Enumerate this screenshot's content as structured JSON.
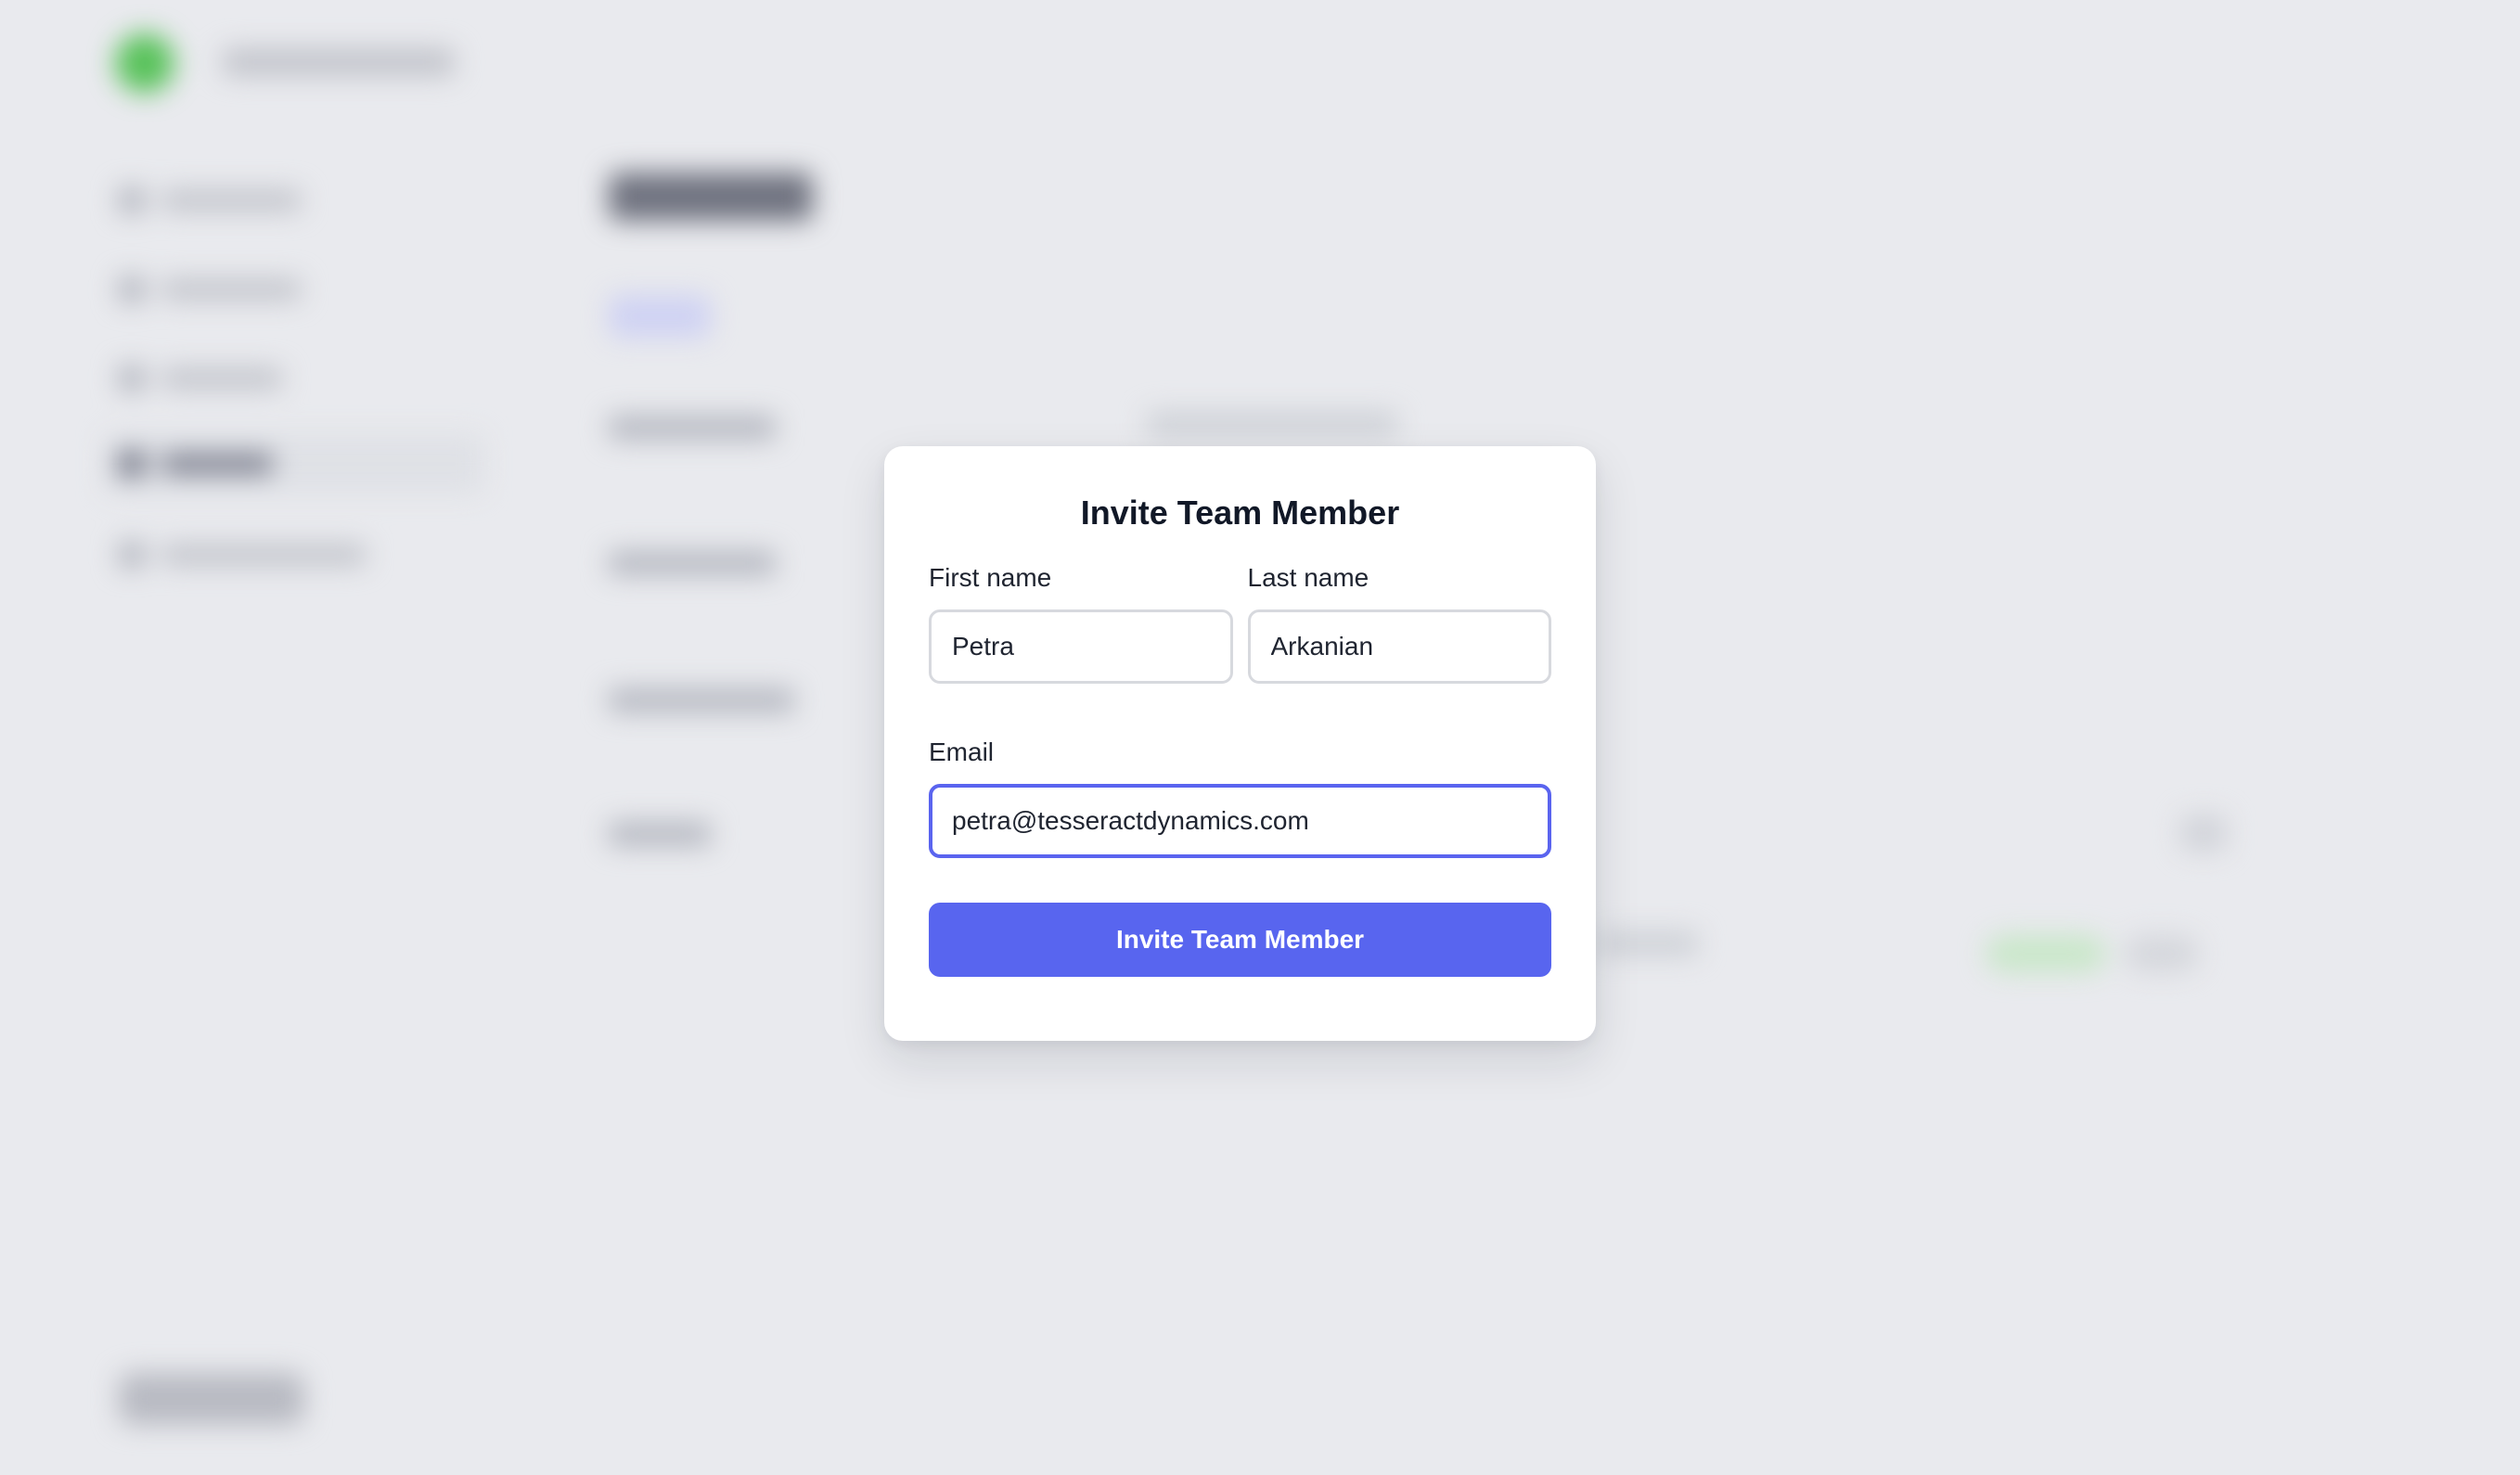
{
  "modal": {
    "title": "Invite Team Member",
    "first_name": {
      "label": "First name",
      "value": "Petra"
    },
    "last_name": {
      "label": "Last name",
      "value": "Arkanian"
    },
    "email": {
      "label": "Email",
      "value": "petra@tesseractdynamics.com"
    },
    "submit_label": "Invite Team Member"
  },
  "colors": {
    "accent": "#5865ef",
    "focus_border": "#5a64ef",
    "backdrop": "#e9eaee",
    "brand": "#58c25a"
  }
}
